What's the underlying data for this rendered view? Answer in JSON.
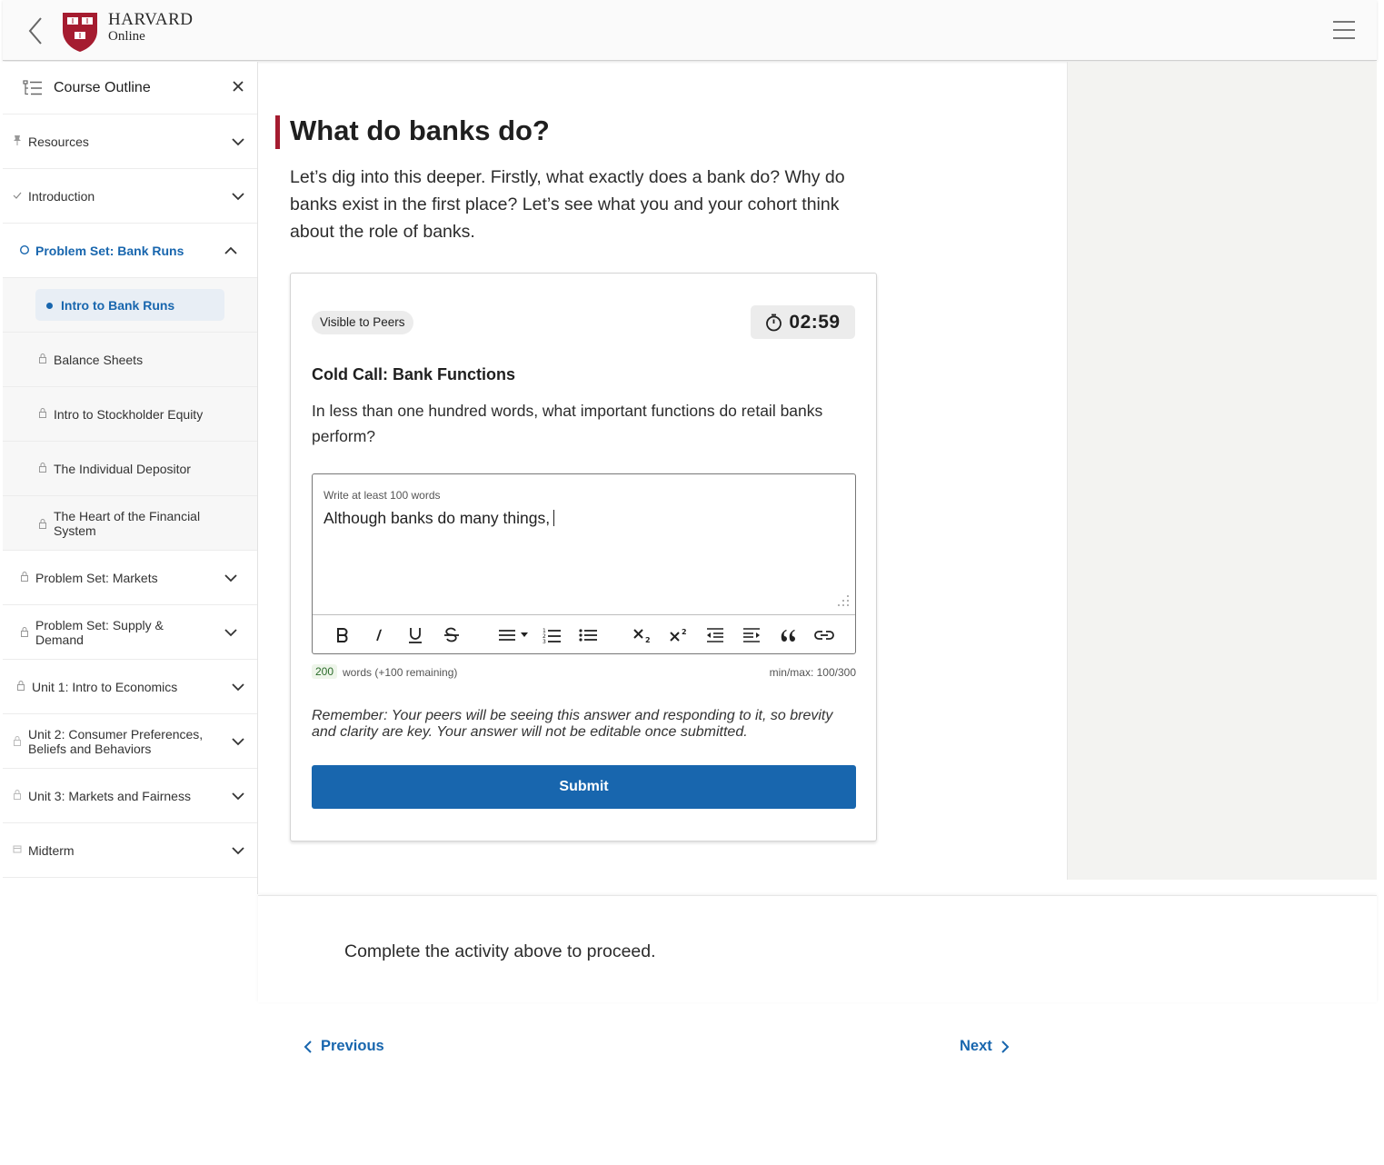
{
  "header": {
    "logo_main": "HARVARD",
    "logo_sub": "Online"
  },
  "sidebar": {
    "title": "Course Outline",
    "items": [
      {
        "label": "Resources",
        "icon": "pin-icon"
      },
      {
        "label": "Introduction",
        "icon": "check-icon"
      },
      {
        "label": "Problem Set: Bank Runs",
        "icon": "circle-icon",
        "expanded": true
      },
      {
        "label": "Intro to Bank Runs",
        "icon": "dot-icon",
        "active": true
      },
      {
        "label": "Balance Sheets",
        "icon": "lock-icon"
      },
      {
        "label": "Intro to Stockholder Equity",
        "icon": "lock-icon"
      },
      {
        "label": "The Individual Depositor",
        "icon": "lock-icon"
      },
      {
        "label": "The Heart of the Financial System",
        "icon": "lock-icon"
      },
      {
        "label": "Problem Set: Markets",
        "icon": "lock-icon"
      },
      {
        "label": "Problem Set: Supply & Demand",
        "icon": "lock-icon"
      },
      {
        "label": "Unit 1: Intro to Economics",
        "icon": "lock-icon"
      },
      {
        "label": "Unit 2: Consumer Preferences, Beliefs and Behaviors",
        "icon": "lock-icon"
      },
      {
        "label": "Unit 3: Markets and Fairness",
        "icon": "lock-icon"
      },
      {
        "label": "Midterm",
        "icon": "calendar-icon"
      }
    ]
  },
  "main": {
    "title": "What do banks do?",
    "intro": "Let’s dig into this deeper. Firstly, what exactly does a bank do? Why do banks exist in the first place? Let’s see what you and your cohort think about the role of banks."
  },
  "activity": {
    "badge": "Visible to Peers",
    "timer": "02:59",
    "question_title": "Cold Call: Bank Functions",
    "question_text": "In less than one hundred words, what important functions do retail banks perform?",
    "editor_label": "Write at least 100 words",
    "editor_value": "Although banks do many things,",
    "word_count": "200",
    "word_count_text": "words (+100 remaining)",
    "minmax": "min/max: 100/300",
    "remember": "Remember: Your peers will be seeing this answer and responding to it, so brevity and clarity are key. Your answer will not be editable once submitted.",
    "submit_label": "Submit"
  },
  "footer": {
    "proceed_text": "Complete the activity above to proceed.",
    "previous_label": "Previous",
    "next_label": "Next"
  },
  "colors": {
    "accent_blue": "#1866ae",
    "harvard_crimson": "#a51c30",
    "panel_gray": "#f3f3f1"
  }
}
